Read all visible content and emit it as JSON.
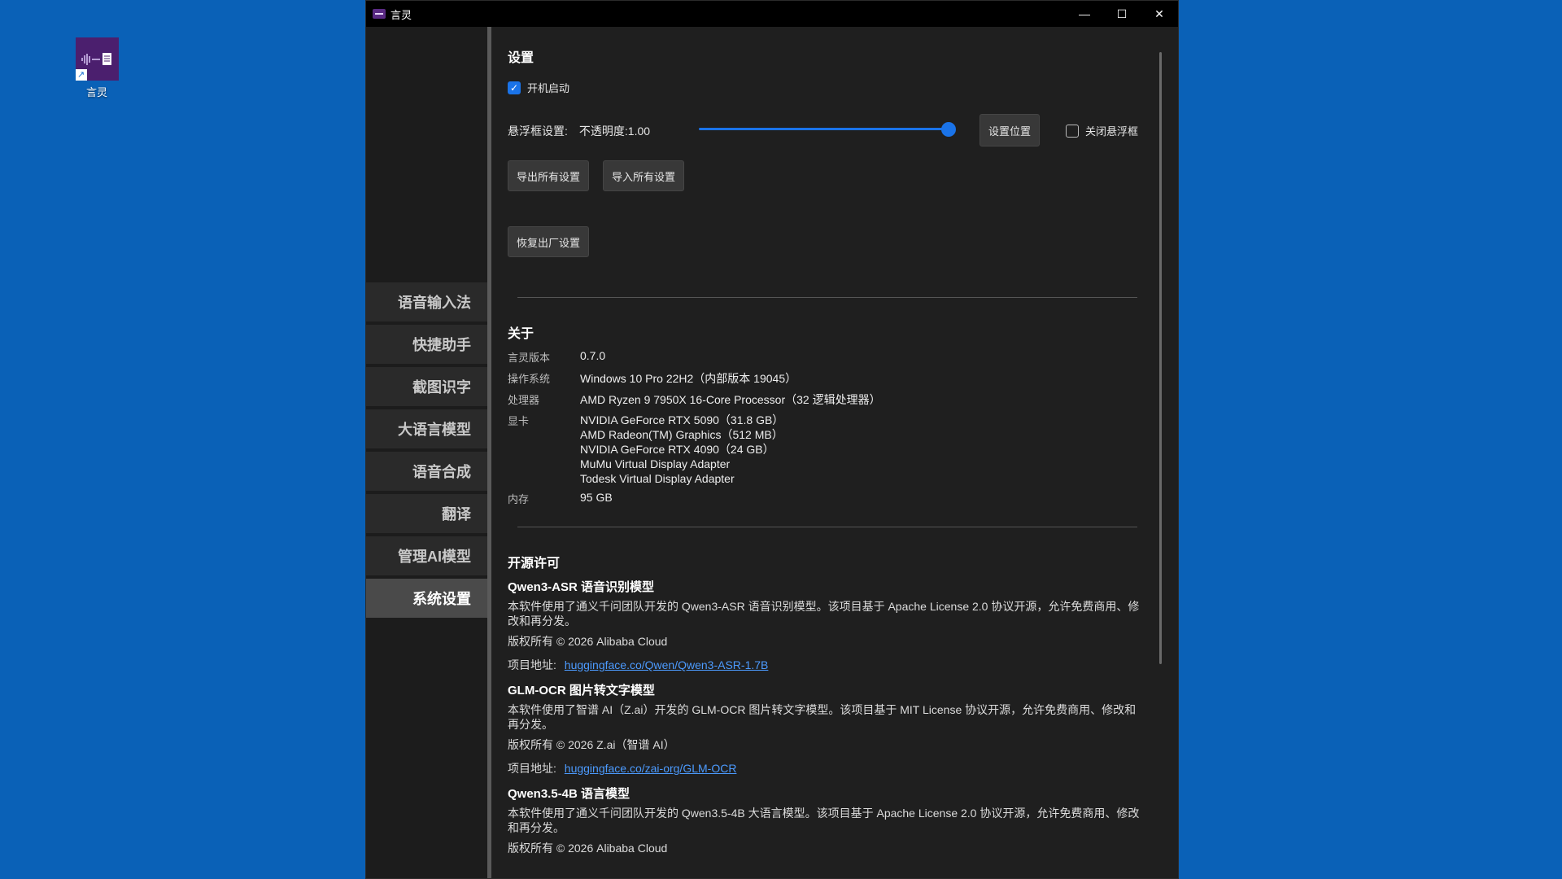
{
  "desktop": {
    "icon_label": "言灵"
  },
  "window": {
    "title": "言灵",
    "controls": {
      "minimize": "—",
      "maximize": "☐",
      "close": "✕"
    }
  },
  "sidebar": {
    "items": [
      {
        "label": "语音输入法"
      },
      {
        "label": "快捷助手"
      },
      {
        "label": "截图识字"
      },
      {
        "label": "大语言模型"
      },
      {
        "label": "语音合成"
      },
      {
        "label": "翻译"
      },
      {
        "label": "管理AI模型"
      },
      {
        "label": "系统设置"
      }
    ],
    "active_index": 7
  },
  "settings": {
    "heading": "设置",
    "autostart_label": "开机启动",
    "autostart_checked": true,
    "float_label": "悬浮框设置:",
    "opacity_label": "不透明度:",
    "opacity_value": "1.00",
    "opacity_level": 1.0,
    "set_position_button": "设置位置",
    "close_float_label": "关闭悬浮框",
    "close_float_checked": false,
    "export_button": "导出所有设置",
    "import_button": "导入所有设置",
    "reset_button": "恢复出厂设置"
  },
  "about": {
    "heading": "关于",
    "version_key": "言灵版本",
    "version": "0.7.0",
    "os_key": "操作系统",
    "os": "Windows 10 Pro 22H2（内部版本 19045）",
    "cpu_key": "处理器",
    "cpu": "AMD Ryzen 9 7950X 16-Core Processor（32 逻辑处理器）",
    "gpu_key": "显卡",
    "gpus": [
      "NVIDIA GeForce RTX 5090（31.8 GB）",
      "AMD Radeon(TM) Graphics（512 MB）",
      "NVIDIA GeForce RTX 4090（24 GB）",
      "MuMu Virtual Display Adapter",
      "Todesk Virtual Display Adapter"
    ],
    "mem_key": "内存",
    "mem": "95 GB"
  },
  "licenses": {
    "heading": "开源许可",
    "items": [
      {
        "title": "Qwen3-ASR 语音识别模型",
        "desc": "本软件使用了通义千问团队开发的 Qwen3-ASR 语音识别模型。该项目基于 Apache License 2.0 协议开源，允许免费商用、修改和再分发。",
        "copyright": "版权所有 © 2026 Alibaba Cloud",
        "link_label": "项目地址:",
        "link": "huggingface.co/Qwen/Qwen3-ASR-1.7B"
      },
      {
        "title": "GLM-OCR 图片转文字模型",
        "desc": "本软件使用了智谱 AI（Z.ai）开发的 GLM-OCR 图片转文字模型。该项目基于 MIT License 协议开源，允许免费商用、修改和再分发。",
        "copyright": "版权所有 © 2026 Z.ai（智谱 AI）",
        "link_label": "项目地址:",
        "link": "huggingface.co/zai-org/GLM-OCR"
      },
      {
        "title": "Qwen3.5-4B 语言模型",
        "desc": "本软件使用了通义千问团队开发的 Qwen3.5-4B 大语言模型。该项目基于 Apache License 2.0 协议开源，允许免费商用、修改和再分发。",
        "copyright": "版权所有 © 2026 Alibaba Cloud"
      }
    ]
  }
}
